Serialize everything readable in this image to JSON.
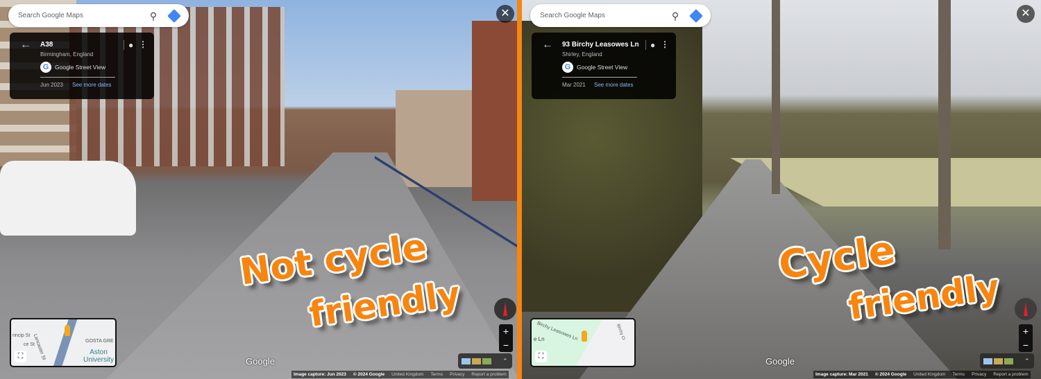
{
  "accent_color": "#f7850f",
  "left": {
    "search_placeholder": "Search Google Maps",
    "title": "A38",
    "subtitle": "Birmingham, England",
    "source": "Google Street View",
    "date": "Jun 2023",
    "more_dates": "See more dates",
    "minimap_labels": [
      "Lancaster St",
      "GOSTA GRE",
      "Aston University",
      "rincip St",
      "ce St"
    ],
    "google": "Google",
    "footer": {
      "capture": "Image capture: Jun 2023",
      "copyright": "© 2024 Google",
      "region": "United Kingdom",
      "terms": "Terms",
      "privacy": "Privacy",
      "report": "Report a problem"
    },
    "overlay": {
      "line1": "Not cycle",
      "line2": "friendly"
    }
  },
  "right": {
    "search_placeholder": "Search Google Maps",
    "title": "93 Birchy Leasowes Ln",
    "subtitle": "Shirley, England",
    "source": "Google Street View",
    "date": "Mar 2021",
    "more_dates": "See more dates",
    "minimap_labels": [
      "Birchy Leasowes Ln",
      "Birchy Cl",
      "e Ln"
    ],
    "google": "Google",
    "footer": {
      "capture": "Image capture: Mar 2021",
      "copyright": "© 2024 Google",
      "region": "United Kingdom",
      "terms": "Terms",
      "privacy": "Privacy",
      "report": "Report a problem"
    },
    "overlay": {
      "line1": "Cycle",
      "line2": "friendly"
    }
  },
  "icons": {
    "search": "search-icon",
    "directions": "directions-icon",
    "back": "arrow-left-icon",
    "pin": "location-pin-icon",
    "more": "more-vert-icon",
    "close": "close-icon",
    "compass": "compass-icon",
    "zoom_in": "plus-icon",
    "zoom_out": "minus-icon",
    "fullscreen": "fullscreen-icon",
    "expand": "chevron-double-up-icon"
  }
}
